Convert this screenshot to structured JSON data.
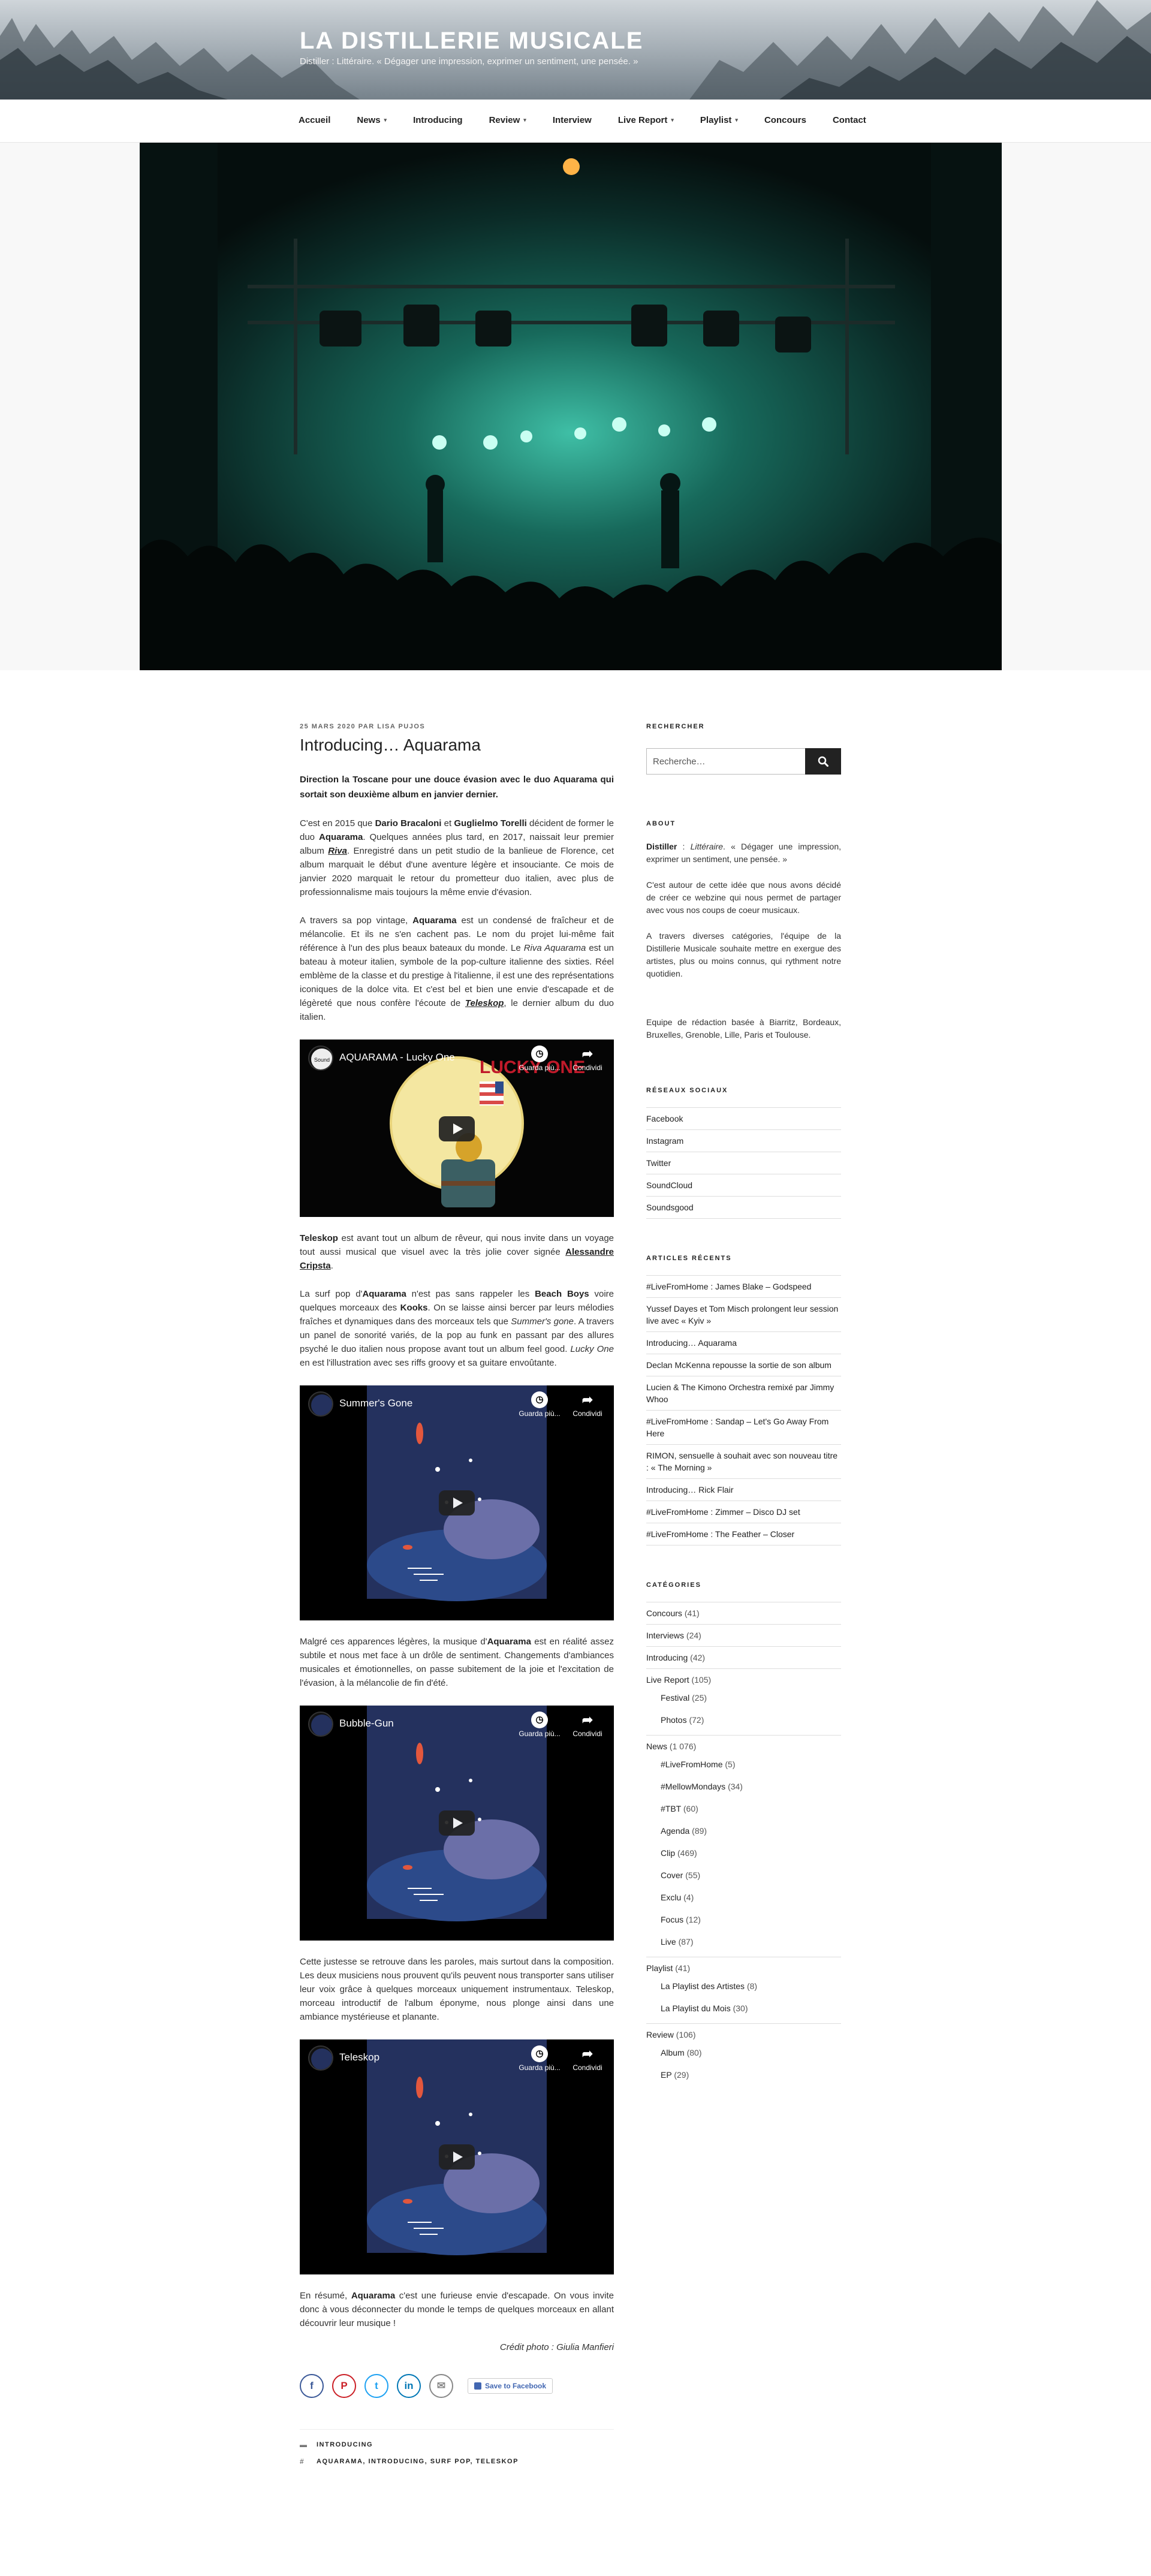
{
  "site": {
    "title": "LA DISTILLERIE MUSICALE",
    "description": "Distiller : Littéraire. « Dégager une impression, exprimer un sentiment, une pensée. »"
  },
  "nav": [
    {
      "label": "Accueil",
      "dropdown": false
    },
    {
      "label": "News",
      "dropdown": true
    },
    {
      "label": "Introducing",
      "dropdown": false
    },
    {
      "label": "Review",
      "dropdown": true
    },
    {
      "label": "Interview",
      "dropdown": false
    },
    {
      "label": "Live Report",
      "dropdown": true
    },
    {
      "label": "Playlist",
      "dropdown": true
    },
    {
      "label": "Concours",
      "dropdown": false
    },
    {
      "label": "Contact",
      "dropdown": false
    }
  ],
  "post": {
    "date": "25 MARS 2020",
    "by": "PAR",
    "author": "LISA PUJOS",
    "title": "Introducing… Aquarama",
    "intro": "Direction la Toscane pour une douce évasion avec le duo Aquarama qui sortait son deuxième album en janvier dernier.",
    "p1": {
      "a": "C'est en 2015 que ",
      "b1": "Dario Bracaloni",
      "c": " et ",
      "b2": "Guglielmo Torelli",
      "d": " décident de former le duo ",
      "b3": "Aquarama",
      "e": ". Quelques années plus tard, en 2017, naissait leur premier album ",
      "u1": "Riva",
      "f": ". Enregistré dans un petit studio de la banlieue de Florence, cet album marquait le début d'une aventure légère et insouciante. Ce mois de janvier 2020 marquait le retour du prometteur duo italien, avec plus de professionnalisme mais toujours la même envie d'évasion."
    },
    "p2": {
      "a": "A travers sa pop vintage, ",
      "b1": "Aquarama",
      "c": " est un condensé de fraîcheur et de mélancolie. Et ils ne s'en cachent pas. Le nom du projet lui-même fait référence à l'un des plus beaux bateaux du monde. Le ",
      "i1": "Riva Aquarama",
      "d": " est un bateau à moteur italien, symbole de la pop-culture italienne des sixties. Réel emblème de la classe et du prestige à l'italienne, il est une des représentations iconiques de la dolce vita. Et c'est bel et bien une envie d'escapade et de légèreté que nous confère l'écoute de ",
      "u1": "Teleskop",
      "e": ", le dernier album du duo italien."
    },
    "p3": {
      "b1": "Teleskop",
      "a": " est avant tout un album de rêveur, qui nous invite dans un voyage tout aussi musical que visuel avec la très jolie cover signée ",
      "u1": "Alessandre Cripsta",
      "b": "."
    },
    "p4": {
      "a": "La surf pop d'",
      "b1": "Aquarama",
      "c": " n'est pas sans rappeler les ",
      "b2": "Beach Boys",
      "d": " voire quelques morceaux des ",
      "b3": "Kooks",
      "e": ". On se laisse ainsi bercer par leurs mélodies fraîches et dynamiques dans des morceaux tels que ",
      "i1": "Summer's gone",
      "f": ". A travers un panel de sonorité variés, de la pop au funk en passant par des allures psyché le duo italien nous propose avant tout un album feel good. ",
      "i2": "Lucky One",
      "g": " en est l'illustration avec ses riffs groovy et sa guitare envoûtante."
    },
    "p5": {
      "a": "Malgré ces apparences légères, la musique d'",
      "b1": "Aquarama",
      "c": " est en réalité assez subtile et nous met face à un drôle de sentiment. Changements d'ambiances musicales et émotionnelles, on passe subitement de la joie et l'excitation de l'évasion, à la mélancolie de fin d'été."
    },
    "p6": "Cette justesse se retrouve dans les paroles, mais surtout dans la composition. Les deux musiciens nous prouvent qu'ils peuvent nous transporter sans utiliser leur voix grâce à quelques morceaux uniquement instrumentaux. Teleskop, morceau introductif de l'album éponyme, nous plonge ainsi dans une ambiance mystérieuse et planante.",
    "p7": {
      "a": "En résumé, ",
      "b1": "Aquarama",
      "c": " c'est une furieuse envie d'escapade. On vous invite donc à vous déconnecter du monde le temps de quelques morceaux en allant découvrir leur musique !"
    },
    "credit": "Crédit photo : Giulia Manfieri",
    "videos": [
      {
        "title": "AQUARAMA - Lucky One",
        "watch_later": "Guarda più...",
        "share": "Condividi"
      },
      {
        "title": "Summer's Gone",
        "watch_later": "Guarda più...",
        "share": "Condividi"
      },
      {
        "title": "Bubble-Gun",
        "watch_later": "Guarda più...",
        "share": "Condividi"
      },
      {
        "title": "Teleskop",
        "watch_later": "Guarda più...",
        "share": "Condividi"
      }
    ],
    "share": {
      "save_label": "Save to Facebook"
    },
    "footer": {
      "category": "INTRODUCING",
      "tags": "AQUARAMA, INTRODUCING, SURF POP, TELESKOP"
    }
  },
  "sidebar": {
    "search": {
      "title": "RECHERCHER",
      "placeholder": "Recherche…"
    },
    "about": {
      "title": "ABOUT",
      "p1_b": "Distiller",
      "p1_a": " : ",
      "p1_i": "Littéraire",
      "p1_c": ". « Dégager une impression, exprimer un sentiment, une pensée. »",
      "p2": "C'est autour de cette idée que nous avons décidé de créer ce webzine qui nous permet de partager avec vous nos coups de coeur musicaux.",
      "p3": "A travers diverses catégories, l'équipe de la Distillerie Musicale souhaite mettre en exergue des artistes, plus ou moins connus, qui rythment notre quotidien.",
      "p4": "Equipe de rédaction basée à Biarritz, Bordeaux, Bruxelles, Grenoble, Lille, Paris et Toulouse."
    },
    "social": {
      "title": "RÉSEAUX SOCIAUX",
      "items": [
        "Facebook",
        "Instagram",
        "Twitter",
        "SoundCloud",
        "Soundsgood"
      ]
    },
    "recent": {
      "title": "ARTICLES RÉCENTS",
      "items": [
        "#LiveFromHome : James Blake – Godspeed",
        "Yussef Dayes et Tom Misch prolongent leur session live avec « Kyiv »",
        "Introducing… Aquarama",
        "Declan McKenna repousse la sortie de son album",
        "Lucien & The Kimono Orchestra remixé par Jimmy Whoo",
        "#LiveFromHome : Sandap – Let's Go Away From Here",
        "RIMON, sensuelle à souhait avec son nouveau titre : « The Morning »",
        "Introducing… Rick Flair",
        "#LiveFromHome : Zimmer – Disco DJ set",
        "#LiveFromHome : The Feather – Closer"
      ]
    },
    "categories": {
      "title": "CATÉGORIES",
      "items": [
        {
          "label": "Concours",
          "count": "(41)",
          "sub": false
        },
        {
          "label": "Interviews",
          "count": "(24)",
          "sub": false
        },
        {
          "label": "Introducing",
          "count": "(42)",
          "sub": false
        },
        {
          "label": "Live Report",
          "count": "(105)",
          "sub": false
        },
        {
          "label": "Festival",
          "count": "(25)",
          "sub": true
        },
        {
          "label": "Photos",
          "count": "(72)",
          "sub": true
        },
        {
          "label": "News",
          "count": "(1 076)",
          "sub": false
        },
        {
          "label": "#LiveFromHome",
          "count": "(5)",
          "sub": true
        },
        {
          "label": "#MellowMondays",
          "count": "(34)",
          "sub": true
        },
        {
          "label": "#TBT",
          "count": "(60)",
          "sub": true
        },
        {
          "label": "Agenda",
          "count": "(89)",
          "sub": true
        },
        {
          "label": "Clip",
          "count": "(469)",
          "sub": true
        },
        {
          "label": "Cover",
          "count": "(55)",
          "sub": true
        },
        {
          "label": "Exclu",
          "count": "(4)",
          "sub": true
        },
        {
          "label": "Focus",
          "count": "(12)",
          "sub": true
        },
        {
          "label": "Live",
          "count": "(87)",
          "sub": true
        },
        {
          "label": "Playlist",
          "count": "(41)",
          "sub": false
        },
        {
          "label": "La Playlist des Artistes",
          "count": "(8)",
          "sub": true
        },
        {
          "label": "La Playlist du Mois",
          "count": "(30)",
          "sub": true
        },
        {
          "label": "Review",
          "count": "(106)",
          "sub": false
        },
        {
          "label": "Album",
          "count": "(80)",
          "sub": true
        },
        {
          "label": "EP",
          "count": "(29)",
          "sub": true
        }
      ]
    }
  },
  "colors": {
    "accent": "#222222",
    "facebook": "#3b5998",
    "pinterest": "#cb2027",
    "twitter": "#1da1f2",
    "linkedin": "#0077b5",
    "email": "#888888"
  }
}
